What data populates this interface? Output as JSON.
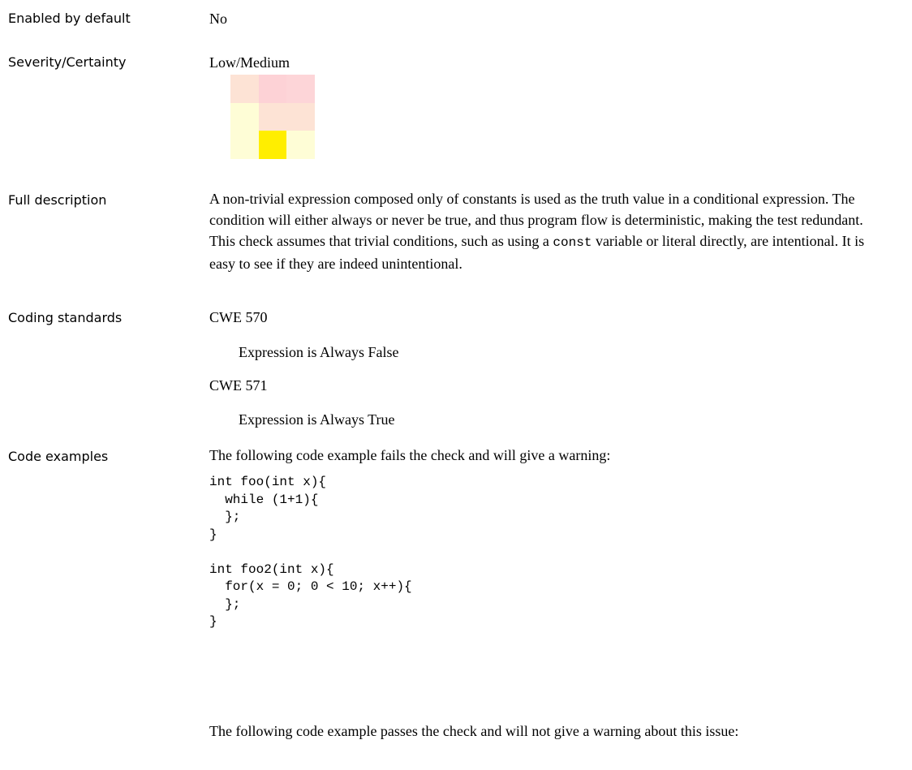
{
  "fields": {
    "enabled": {
      "label": "Enabled by default",
      "value": "No"
    },
    "severity": {
      "label": "Severity/Certainty",
      "value": "Low/Medium"
    },
    "description": {
      "label": "Full description",
      "text_before": " A non-trivial expression composed only of constants is used as the truth value in a conditional expression. The condition will either always or never be true, and thus program flow is deterministic, making the test redundant.  This check assumes that trivial conditions, such as using a ",
      "code": "const",
      "text_after": " variable or literal directly, are intentional. It is easy to see if they are indeed unintentional."
    },
    "standards": {
      "label": "Coding standards",
      "items": [
        {
          "id": "CWE 570",
          "title": "Expression is Always False"
        },
        {
          "id": "CWE 571",
          "title": "Expression is Always True"
        }
      ]
    },
    "examples": {
      "label": "Code examples",
      "fail_intro": "The following code example fails the check and will give a warning:",
      "fail_code": "int foo(int x){\n  while (1+1){\n  };\n}\n\nint foo2(int x){\n  for(x = 0; 0 < 10; x++){\n  };\n}",
      "pass_intro": "The following code example passes the check and will not give a warning about this issue:"
    }
  },
  "severity_matrix": {
    "colors": [
      [
        "#fde3d5",
        "#fdd2d6",
        "#fdd5d8"
      ],
      [
        "#fefdd6",
        "#fde3d5",
        "#fde3d5"
      ],
      [
        "#fefdd6",
        "#ffee00",
        "#fefdd6"
      ]
    ],
    "highlight": {
      "row": 3,
      "col": 2
    }
  }
}
